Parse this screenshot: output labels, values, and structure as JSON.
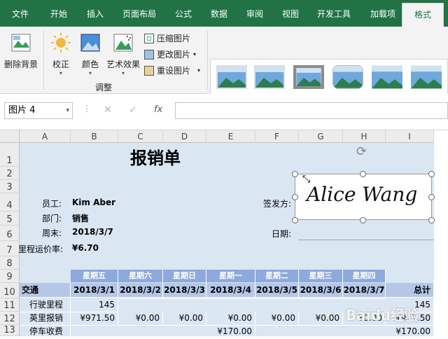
{
  "tabs": [
    "文件",
    "开始",
    "插入",
    "页面布局",
    "公式",
    "数据",
    "审阅",
    "视图",
    "开发工具",
    "加载项",
    "格式"
  ],
  "ribbon": {
    "remove_bg": "删除背景",
    "corrections": "校正",
    "color": "颜色",
    "artistic": "艺术效果",
    "compress": "压缩图片",
    "change": "更改图片",
    "reset": "重设图片",
    "group_adjust": "调整"
  },
  "formula": {
    "name_box": "图片 4",
    "fx": "fx",
    "cancel": "✕",
    "confirm": "✓"
  },
  "columns": [
    "A",
    "B",
    "C",
    "D",
    "E",
    "F",
    "G",
    "H",
    "I"
  ],
  "rows": [
    "1",
    "2",
    "3",
    "4",
    "5",
    "6",
    "7",
    "8",
    "9",
    "10",
    "11",
    "12",
    "13"
  ],
  "sheet": {
    "title": "报销单",
    "employee_label": "员工:",
    "employee": "Kim Aber",
    "dept_label": "部门:",
    "dept": "销售",
    "week_label": "周末:",
    "week": "2018/3/7",
    "rate_label": "里程运价率:",
    "rate": "¥6.70",
    "signer_label": "签发方:",
    "date_label": "日期:",
    "signature": "Alice Wang",
    "weekdays": [
      "星期五",
      "星期六",
      "星期日",
      "星期一",
      "星期二",
      "星期三",
      "星期四"
    ],
    "row10_label": "交通",
    "dates": [
      "2018/3/1",
      "2018/3/2",
      "2018/3/3",
      "2018/3/4",
      "2018/3/5",
      "2018/3/6",
      "2018/3/7"
    ],
    "total_label": "总计",
    "row11": {
      "label": "行驶里程",
      "values": [
        "145",
        "",
        "",
        "",
        "",
        "",
        "",
        ""
      ],
      "total": "145"
    },
    "row12": {
      "label": "英里报销",
      "values": [
        "¥971.50",
        "¥0.00",
        "¥0.00",
        "¥0.00",
        "¥0.00",
        "¥0.00",
        "¥0.00"
      ],
      "total": "¥971.50"
    },
    "row13": {
      "label": "停车收费",
      "values": [
        "",
        "",
        "",
        "¥170.00",
        "",
        "",
        "",
        ""
      ],
      "total": "¥170.00"
    }
  },
  "watermark": "Baidu经验"
}
